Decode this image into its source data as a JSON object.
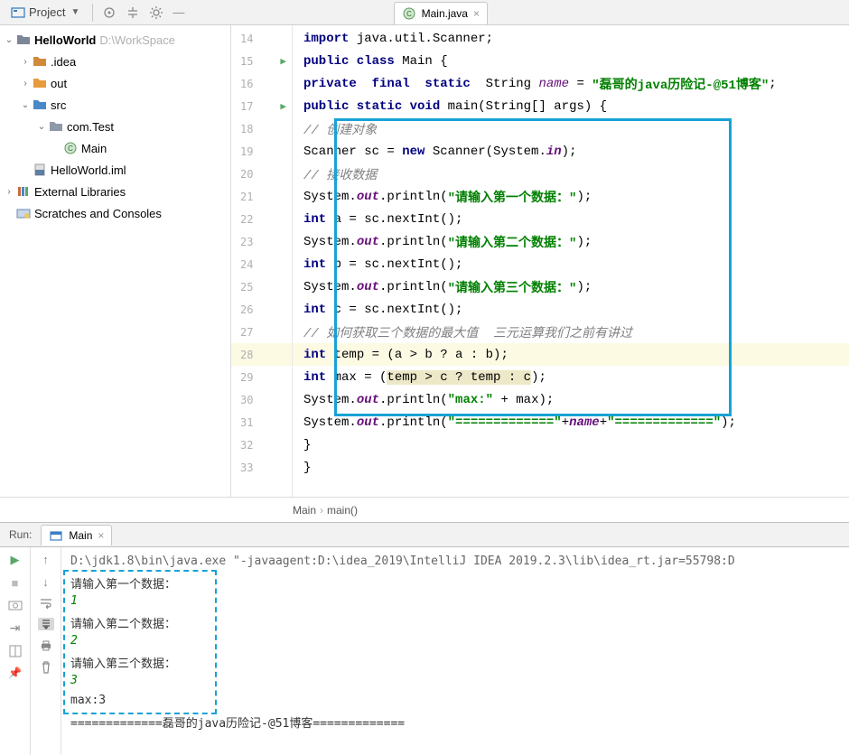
{
  "toolbar": {
    "project_label": "Project"
  },
  "editor_tab": {
    "label": "Main.java"
  },
  "tree": {
    "root": {
      "label": "HelloWorld",
      "path": "D:\\WorkSpace"
    },
    "idea": ".idea",
    "out": "out",
    "src": "src",
    "pkg": "com.Test",
    "main": "Main",
    "iml": "HelloWorld.iml",
    "ext": "External Libraries",
    "scratch": "Scratches and Consoles"
  },
  "gutter": [
    "14",
    "15",
    "16",
    "17",
    "18",
    "19",
    "20",
    "21",
    "22",
    "23",
    "24",
    "25",
    "26",
    "27",
    "28",
    "29",
    "30",
    "31",
    "32",
    "33"
  ],
  "code": {
    "l14_a": "import ",
    "l14_b": "java.util.Scanner;",
    "l15_a": "public class ",
    "l15_b": "Main {",
    "l16_a": "private  final  static  ",
    "l16_b": "String ",
    "l16_name": "name",
    "l16_c": " = ",
    "l16_str": "\"磊哥的java历险记-@51博客\"",
    "l16_d": ";",
    "l17_a": "public static void ",
    "l17_b": "main(String[] args) {",
    "l18": "// 创建对象",
    "l19_a": "Scanner sc = ",
    "l19_new": "new ",
    "l19_b": "Scanner(System.",
    "l19_in": "in",
    "l19_c": ");",
    "l20": "// 接收数据",
    "l21_a": "System.",
    "l21_out": "out",
    "l21_b": ".println(",
    "l21_str": "\"请输入第一个数据：\"",
    "l21_c": ");",
    "l22_a": "int ",
    "l22_b": "a = sc.nextInt();",
    "l23_a": "System.",
    "l23_out": "out",
    "l23_b": ".println(",
    "l23_str": "\"请输入第二个数据：\"",
    "l23_c": ");",
    "l24_a": "int ",
    "l24_b": "b = sc.nextInt();",
    "l25_a": "System.",
    "l25_out": "out",
    "l25_b": ".println(",
    "l25_str": "\"请输入第三个数据：\"",
    "l25_c": ");",
    "l26_a": "int ",
    "l26_b": "c = sc.nextInt();",
    "l27": "// 如何获取三个数据的最大值  三元运算我们之前有讲过",
    "l28_a": "int ",
    "l28_b": "temp = (a > b ? a : b);",
    "l29_a": "int ",
    "l29_b": "max = (",
    "l29_c": "temp > c ? temp : c",
    "l29_d": ");",
    "l30_a": "System.",
    "l30_out": "out",
    "l30_b": ".println(",
    "l30_str": "\"max:\"",
    "l30_c": " + max);",
    "l31_a": "System.",
    "l31_out": "out",
    "l31_b": ".println(",
    "l31_s1": "\"=============\"",
    "l31_c": "+",
    "l31_name": "name",
    "l31_d": "+",
    "l31_s2": "\"=============\"",
    "l31_e": ");",
    "l32": "}",
    "l33": "}"
  },
  "breadcrumb": {
    "a": "Main",
    "b": "main()"
  },
  "run": {
    "label": "Run:",
    "tab": "Main",
    "cmd": "D:\\jdk1.8\\bin\\java.exe \"-javaagent:D:\\idea_2019\\IntelliJ IDEA 2019.2.3\\lib\\idea_rt.jar=55798:D",
    "p1": "请输入第一个数据：",
    "i1": "1",
    "p2": "请输入第二个数据：",
    "i2": "2",
    "p3": "请输入第三个数据：",
    "i3": "3",
    "max": "max:3",
    "footer": "=============磊哥的java历险记-@51博客============="
  }
}
